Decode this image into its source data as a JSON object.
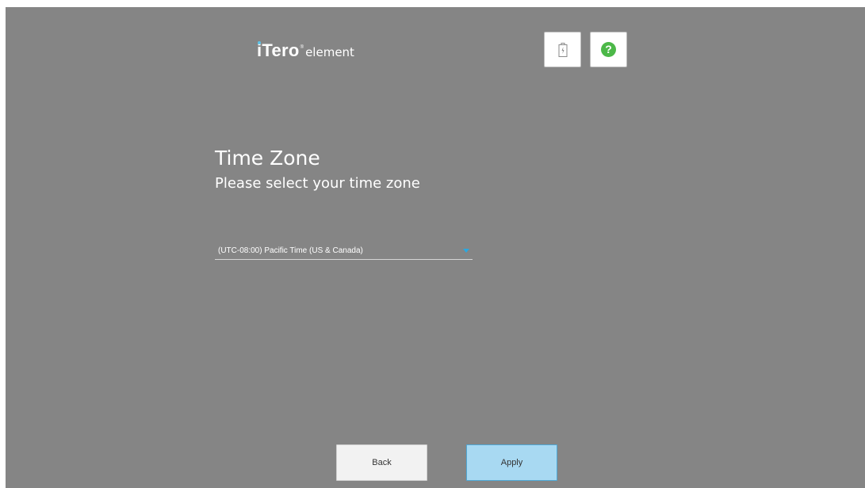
{
  "header": {
    "logo_brand": "iTero",
    "logo_mark": "®",
    "logo_sub": "element",
    "battery_icon": "battery-charging-icon",
    "help_icon": "help-icon",
    "help_glyph": "?"
  },
  "main": {
    "title": "Time Zone",
    "subtitle": "Please select your time zone",
    "timezone_select": {
      "value": "(UTC-08:00) Pacific Time (US & Canada)",
      "arrow_icon": "chevron-down-icon"
    }
  },
  "footer": {
    "back_label": "Back",
    "apply_label": "Apply"
  },
  "colors": {
    "background": "#858585",
    "accent": "#2aa8e0",
    "help_green": "#4cb848",
    "apply_fill": "#a8d9f2"
  }
}
